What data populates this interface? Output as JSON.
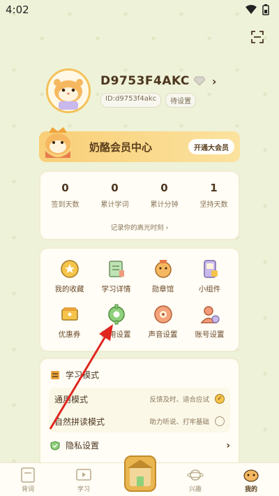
{
  "status_bar": {
    "time": "4:02"
  },
  "profile": {
    "username": "D9753F4AKC",
    "id_tag": "ID:d9753f4akc",
    "pending_tag": "待设置"
  },
  "vip": {
    "title": "奶酪会员中心",
    "button": "开通大会员"
  },
  "stats": [
    {
      "value": "0",
      "label": "签到天数"
    },
    {
      "value": "0",
      "label": "累计学词"
    },
    {
      "value": "0",
      "label": "累计分钟"
    },
    {
      "value": "1",
      "label": "坚持天数"
    }
  ],
  "highlight_link": "记录你的高光时刻 ›",
  "features": [
    {
      "label": "我的收藏",
      "icon": "star-medal-icon"
    },
    {
      "label": "学习详情",
      "icon": "notebook-icon"
    },
    {
      "label": "勋章馆",
      "icon": "badge-icon"
    },
    {
      "label": "小组件",
      "icon": "phone-widget-icon"
    },
    {
      "label": "优惠券",
      "icon": "coupon-icon"
    },
    {
      "label": "通用设置",
      "icon": "gear-icon"
    },
    {
      "label": "声音设置",
      "icon": "speaker-icon"
    },
    {
      "label": "账号设置",
      "icon": "account-icon"
    }
  ],
  "study_mode": {
    "title": "学习模式",
    "options": [
      {
        "name": "通用模式",
        "desc": "反馈及时、适合应试",
        "selected": true
      },
      {
        "name": "自然拼读模式",
        "desc": "助力听说、打牢基础",
        "selected": false
      }
    ]
  },
  "privacy": {
    "label": "隐私设置"
  },
  "bottom_nav": [
    {
      "label": "背词",
      "icon": "abc-book-icon"
    },
    {
      "label": "学习",
      "icon": "video-play-icon"
    },
    {
      "label": "",
      "icon": "house-center-icon"
    },
    {
      "label": "兴趣",
      "icon": "planet-icon"
    },
    {
      "label": "我的",
      "icon": "hamster-face-icon"
    }
  ],
  "colors": {
    "background": "#eef2d8",
    "accent": "#f5c44b",
    "text": "#4d3620",
    "annotation_arrow": "#e0261f"
  }
}
